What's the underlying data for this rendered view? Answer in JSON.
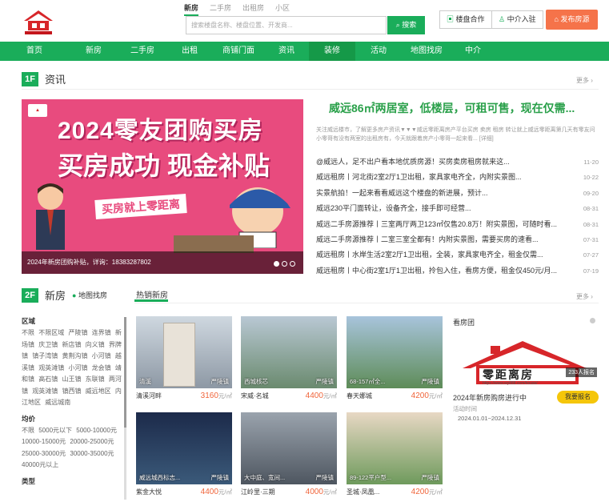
{
  "header": {
    "search_tabs": [
      "新房",
      "二手房",
      "出租房",
      "小区"
    ],
    "search_placeholder": "搜索楼盘名称、楼盘位置、开发商...",
    "search_button": "搜索",
    "partner_button": "楼盘合作",
    "agent_button": "中介入驻",
    "publish_button": "发布房源"
  },
  "nav": [
    "首页",
    "新房",
    "二手房",
    "出租",
    "商铺门面",
    "资讯",
    "装修",
    "活动",
    "地图找房",
    "中介"
  ],
  "news": {
    "badge": "1F",
    "title": "资讯",
    "more": "更多",
    "banner_line1": "2024零友团购买房",
    "banner_line2": "买房成功  现金补贴",
    "banner_caption": "2024年新房团购补贴，详询：18383287802",
    "headline": "威远86㎡两居室，低楼层，可租可售，现在仅需...",
    "summary": "关注威远楼市，了解更多房产资讯▼▼▼威远零距离房产平台买房 卖房 租房 转让就上威远零距离第几天有零友问小零哥有没有两室的出租房有，今天就跟着房产小零哥一起来看... [详细]",
    "items": [
      {
        "title": "@威远人，足不出户看本地优质房源！买房卖房租房就来这...",
        "date": "11-20"
      },
      {
        "title": "威远租房丨河北街2室2厅1卫出租，家具家电齐全，内附实景图...",
        "date": "10-22"
      },
      {
        "title": "实景航拍！一起来看看威远这个楼盘的新进展，预计...",
        "date": "09-20"
      },
      {
        "title": "威远230平门面转让，设备齐全，接手即可经营...",
        "date": "08-31"
      },
      {
        "title": "威远二手房源推荐丨三室两厅两卫123㎡仅售20.8万！附实景图，可随时看...",
        "date": "08-31"
      },
      {
        "title": "威远二手房源推荐丨二室三室全都有！内附实景图，需要买房的速看...",
        "date": "07-31"
      },
      {
        "title": "威远租房丨水岸生活2室2厅1卫出租，全装，家具家电齐全，租金仅需...",
        "date": "07-27"
      },
      {
        "title": "威远租房丨中心街2室1厅1卫出租，拎包入住，看房方便，租金仅450元/月...",
        "date": "07-19"
      }
    ]
  },
  "newhomes": {
    "badge": "2F",
    "title": "新房",
    "map_link": "地图找房",
    "tab": "热销新房",
    "more": "更多",
    "filters": {
      "area_title": "区域",
      "areas": "不限 不限区域 严陵镇 连界镇 新场镇 庆卫镇 新店镇 向义镇 界牌镇 镇子湾镇 黄荆沟镇 小河镇 越溪镇 观英滩镇 小河镇 龙会镇 靖和镇 高石镇 山王镇 东联镇 两河镇 观英滩镇 镇西镇 威远地区 内江地区 威远城南",
      "price_title": "均价",
      "prices": "不限 5000元以下 5000-10000元 10000-15000元 20000-25000元 25000-30000元 30000-35000元 40000元以上",
      "type_title": "类型"
    },
    "unit": "元/㎡",
    "cards": [
      {
        "img_label": "清溪",
        "district": "严陵镇",
        "name": "清溪河畔",
        "price": "3160"
      },
      {
        "img_label": "西城核芯",
        "district": "严陵镇",
        "name": "宋威·名城",
        "price": "4400"
      },
      {
        "img_label": "68-157㎡全...",
        "district": "严陵镇",
        "name": "春天娜城",
        "price": "4200"
      },
      {
        "img_label": "威远城西标志...",
        "district": "严陵镇",
        "name": "紫金大悦",
        "price": "4400"
      },
      {
        "img_label": "大中庭、宽间...",
        "district": "严陵镇",
        "name": "江岭里·三期",
        "price": "4000"
      },
      {
        "img_label": "89-122平户型...",
        "district": "严陵镇",
        "name": "圣城·凤凰...",
        "price": "4200"
      }
    ],
    "group": {
      "title": "看房团",
      "logo_text": "零距离房",
      "logo_url": "https://www.wy888.com/house/",
      "count": "233人报名",
      "event": "2024年新房购房进行中",
      "time_label": "活动时间",
      "date_range": "2024.01.01~2024.12.31",
      "signup": "我要报名"
    }
  }
}
